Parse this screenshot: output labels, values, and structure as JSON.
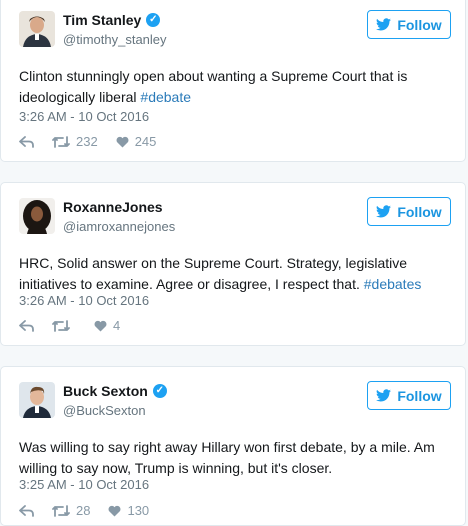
{
  "tweets": [
    {
      "name": "Tim Stanley",
      "verified": true,
      "handle": "@timothy_stanley",
      "follow_label": "Follow",
      "text_plain": "Clinton stunningly open about wanting a Supreme Court that is ideologically liberal ",
      "hashtag": "#debate",
      "time": "3:26 AM - 10 Oct 2016",
      "retweets": "232",
      "likes": "245"
    },
    {
      "name": "RoxanneJones",
      "verified": false,
      "handle": "@iamroxannejones",
      "follow_label": "Follow",
      "text_plain": "HRC, Solid answer on the Supreme Court. Strategy, legislative initiatives to examine. Agree or disagree, I respect that. ",
      "hashtag": "#debates",
      "time": "3:26 AM - 10 Oct 2016",
      "retweets": "",
      "likes": "4"
    },
    {
      "name": "Buck Sexton",
      "verified": true,
      "handle": "@BuckSexton",
      "follow_label": "Follow",
      "text_plain": "Was willing to say right away Hillary won first debate, by a mile. Am willing to say now, Trump is winning, but it's closer.",
      "hashtag": "",
      "time": "3:25 AM - 10 Oct 2016",
      "retweets": "28",
      "likes": "130"
    }
  ],
  "colors": {
    "accent": "#1da1f2",
    "link": "#2b7bb9",
    "muted": "#66757f",
    "background": "#f5f8fa"
  },
  "icons": [
    "reply-icon",
    "retweet-icon",
    "like-icon",
    "twitter-bird-icon",
    "verified-badge-icon"
  ]
}
